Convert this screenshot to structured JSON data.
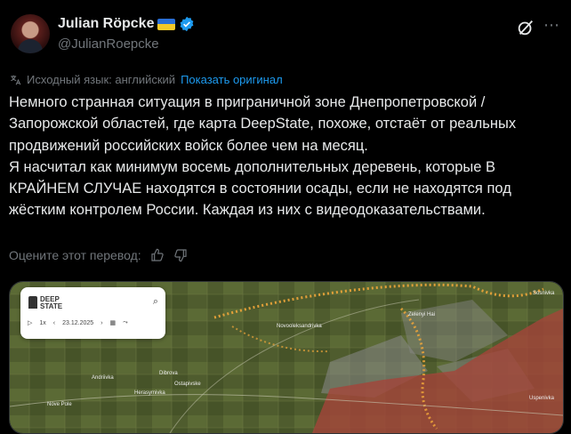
{
  "author": {
    "name": "Julian Röpcke",
    "handle": "@JulianRoepcke"
  },
  "icons": {
    "avatar": "avatar",
    "flag": "ukraine-flag-icon",
    "verified": "verified-badge-icon",
    "grok": "grok-icon",
    "more": "more-options-icon",
    "translate": "translate-icon",
    "thumbs_up": "thumbs-up-icon",
    "thumbs_down": "thumbs-down-icon"
  },
  "colors": {
    "accent": "#1d9bf0",
    "text": "#e7e9ea",
    "muted": "#71767b",
    "bg": "#000000"
  },
  "translation": {
    "source_lang": "Исходный язык: английский",
    "show_original": "Показать оригинал"
  },
  "tweet": {
    "para1": "Немного странная ситуация в приграничной зоне Днепропетровской / Запорожской областей, где карта DeepState, похоже, отстаёт от реальных продвижений российских войск более чем на месяц.",
    "para2": "Я насчитал как минимум восемь дополнительных деревень, которые В КРАЙНЕМ СЛУЧАЕ находятся в состоянии осады, если не находятся под жёстким контролем России. Каждая из них с видеодоказательствами."
  },
  "rating": {
    "label": "Оцените этот перевод:"
  },
  "media": {
    "panel": {
      "logo_line1": "DEEP",
      "logo_line2": "STATE",
      "speed": "1x",
      "date": "23.12.2025"
    },
    "place_labels": {
      "a": "Novooleksandrivka",
      "b": "Sosnivka",
      "c": "Dibrova",
      "d": "Ostapivske",
      "e": "Andriivka",
      "f": "Herasymivka",
      "g": "Nove Pole",
      "h": "Zelenyi Hai",
      "i": "Uspenivka"
    }
  }
}
